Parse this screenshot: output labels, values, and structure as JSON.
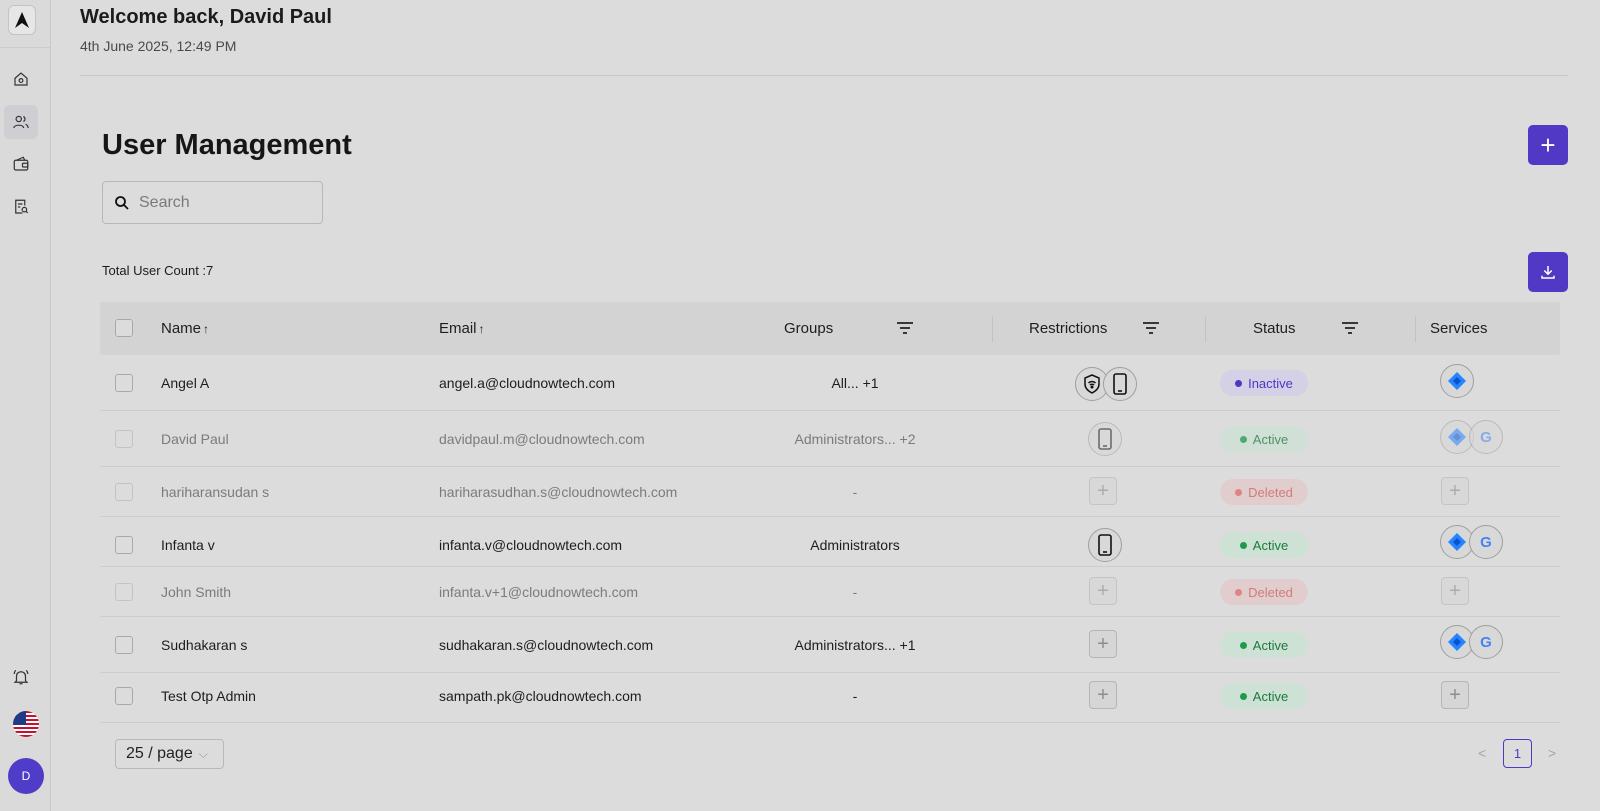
{
  "header": {
    "welcome": "Welcome back, David Paul",
    "datetime": "4th June 2025, 12:49 PM"
  },
  "sidebar": {
    "items": [
      {
        "name": "home",
        "icon": "home-icon"
      },
      {
        "name": "users",
        "icon": "users-icon",
        "active": true
      },
      {
        "name": "wallet",
        "icon": "wallet-icon"
      },
      {
        "name": "reports",
        "icon": "report-search-icon"
      }
    ],
    "bottom": {
      "notifications_icon": "bell-icon",
      "language_icon": "us-flag-icon",
      "avatar_initial": "D"
    }
  },
  "main": {
    "title": "User Management",
    "search_placeholder": "Search",
    "total_count": "Total User Count :7",
    "add_label": "+"
  },
  "table": {
    "headers": {
      "name": "Name",
      "email": "Email",
      "groups": "Groups",
      "restrictions": "Restrictions",
      "status": "Status",
      "services": "Services"
    },
    "rows": [
      {
        "name": "Angel A",
        "email": "angel.a@cloudnowtech.com",
        "groups": "All... +1",
        "restrictions": [
          "wifi-shield-icon",
          "phone-icon"
        ],
        "status": "Inactive",
        "services": [
          "jira-icon"
        ],
        "dim": false
      },
      {
        "name": "David Paul",
        "email": "davidpaul.m@cloudnowtech.com",
        "groups": "Administrators... +2",
        "restrictions": [
          "phone-icon"
        ],
        "status": "Active",
        "services": [
          "jira-icon",
          "google-icon"
        ],
        "dim": true
      },
      {
        "name": "hariharansudan s",
        "email": "hariharasudhan.s@cloudnowtech.com",
        "groups": "-",
        "restrictions": [],
        "status": "Deleted",
        "services": [],
        "dim": true
      },
      {
        "name": "Infanta v",
        "email": "infanta.v@cloudnowtech.com",
        "groups": "Administrators",
        "restrictions": [
          "phone-icon"
        ],
        "status": "Active",
        "services": [
          "jira-icon",
          "google-icon"
        ],
        "dim": false
      },
      {
        "name": "John Smith",
        "email": "infanta.v+1@cloudnowtech.com",
        "groups": "-",
        "restrictions": [],
        "status": "Deleted",
        "services": [],
        "dim": true
      },
      {
        "name": "Sudhakaran s",
        "email": "sudhakaran.s@cloudnowtech.com",
        "groups": "Administrators... +1",
        "restrictions": [],
        "status": "Active",
        "services": [
          "jira-icon",
          "google-icon"
        ],
        "dim": false
      },
      {
        "name": "Test Otp Admin",
        "email": "sampath.pk@cloudnowtech.com",
        "groups": "-",
        "restrictions": [],
        "status": "Active",
        "services": [],
        "dim": false
      }
    ]
  },
  "pagination": {
    "page_size": "25 / page",
    "current_page": "1",
    "prev": "<",
    "next": ">"
  },
  "colors": {
    "accent": "#5139c6",
    "active": "#1f9a4b",
    "deleted": "#e06666",
    "inactive": "#4b38c3"
  }
}
